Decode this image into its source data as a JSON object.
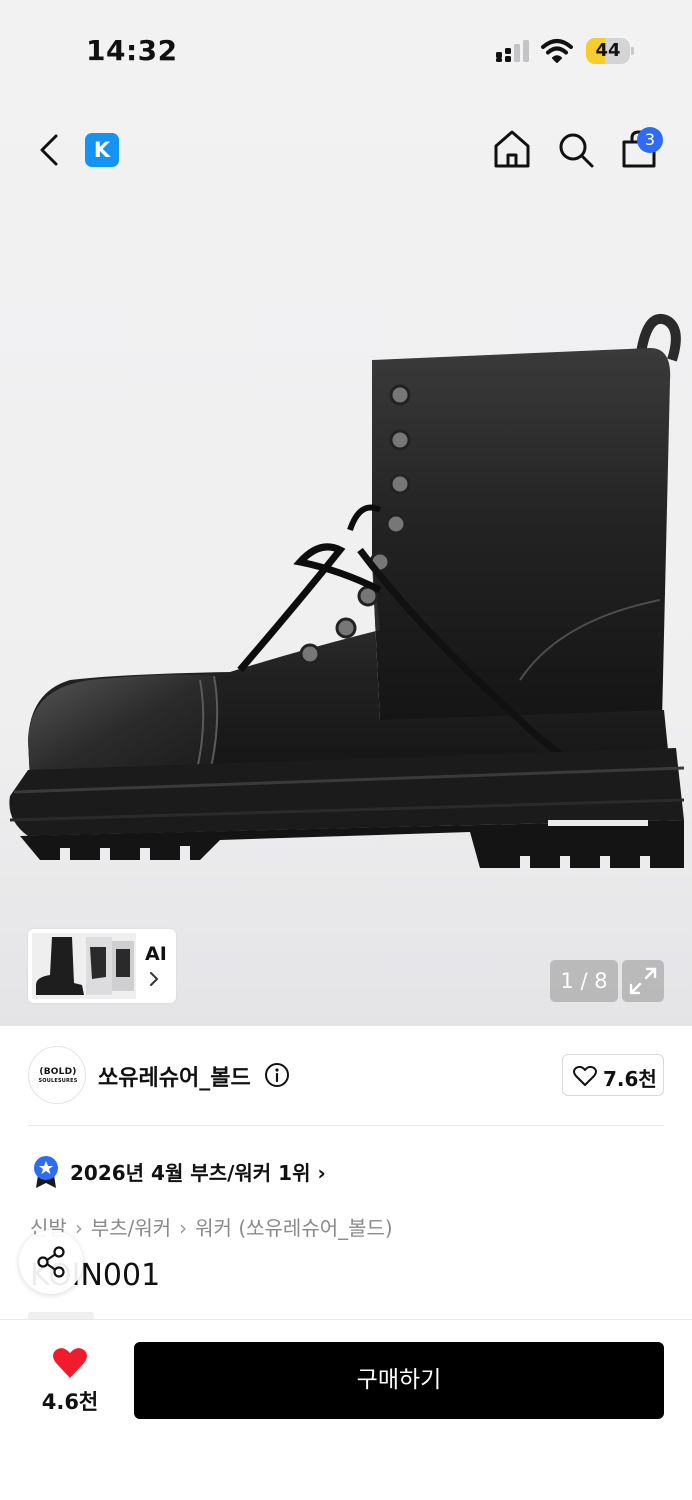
{
  "status_bar": {
    "time": "14:32",
    "battery_level": "44",
    "battery_fraction": 0.44
  },
  "nav": {
    "brand_logo_letter": "K",
    "cart_count": "3",
    "icons": [
      "back-icon",
      "home-icon",
      "search-icon",
      "cart-icon"
    ]
  },
  "gallery": {
    "ai_label": "AI",
    "page_counter": "1 / 8"
  },
  "shop": {
    "avatar_text": "(BOLD)",
    "avatar_subtext": "SOULESURES",
    "name": "쏘유레슈어_볼드",
    "like_count": "7.6천"
  },
  "ranking": {
    "text": "2026년 4월 부츠/워커 1위 ›"
  },
  "breadcrumb": {
    "items": [
      "신발",
      "부츠/워커",
      "워커 (쏘유레슈어_볼드)"
    ]
  },
  "product": {
    "code": "KOIN001"
  },
  "bottom_bar": {
    "wish_count": "4.6천",
    "buy_label": "구매하기"
  },
  "colors": {
    "brand_blue": "#1493f5",
    "badge_blue": "#2f6cf6",
    "heart_red": "#f21a2b",
    "battery_yellow": "#f6cd2a"
  }
}
